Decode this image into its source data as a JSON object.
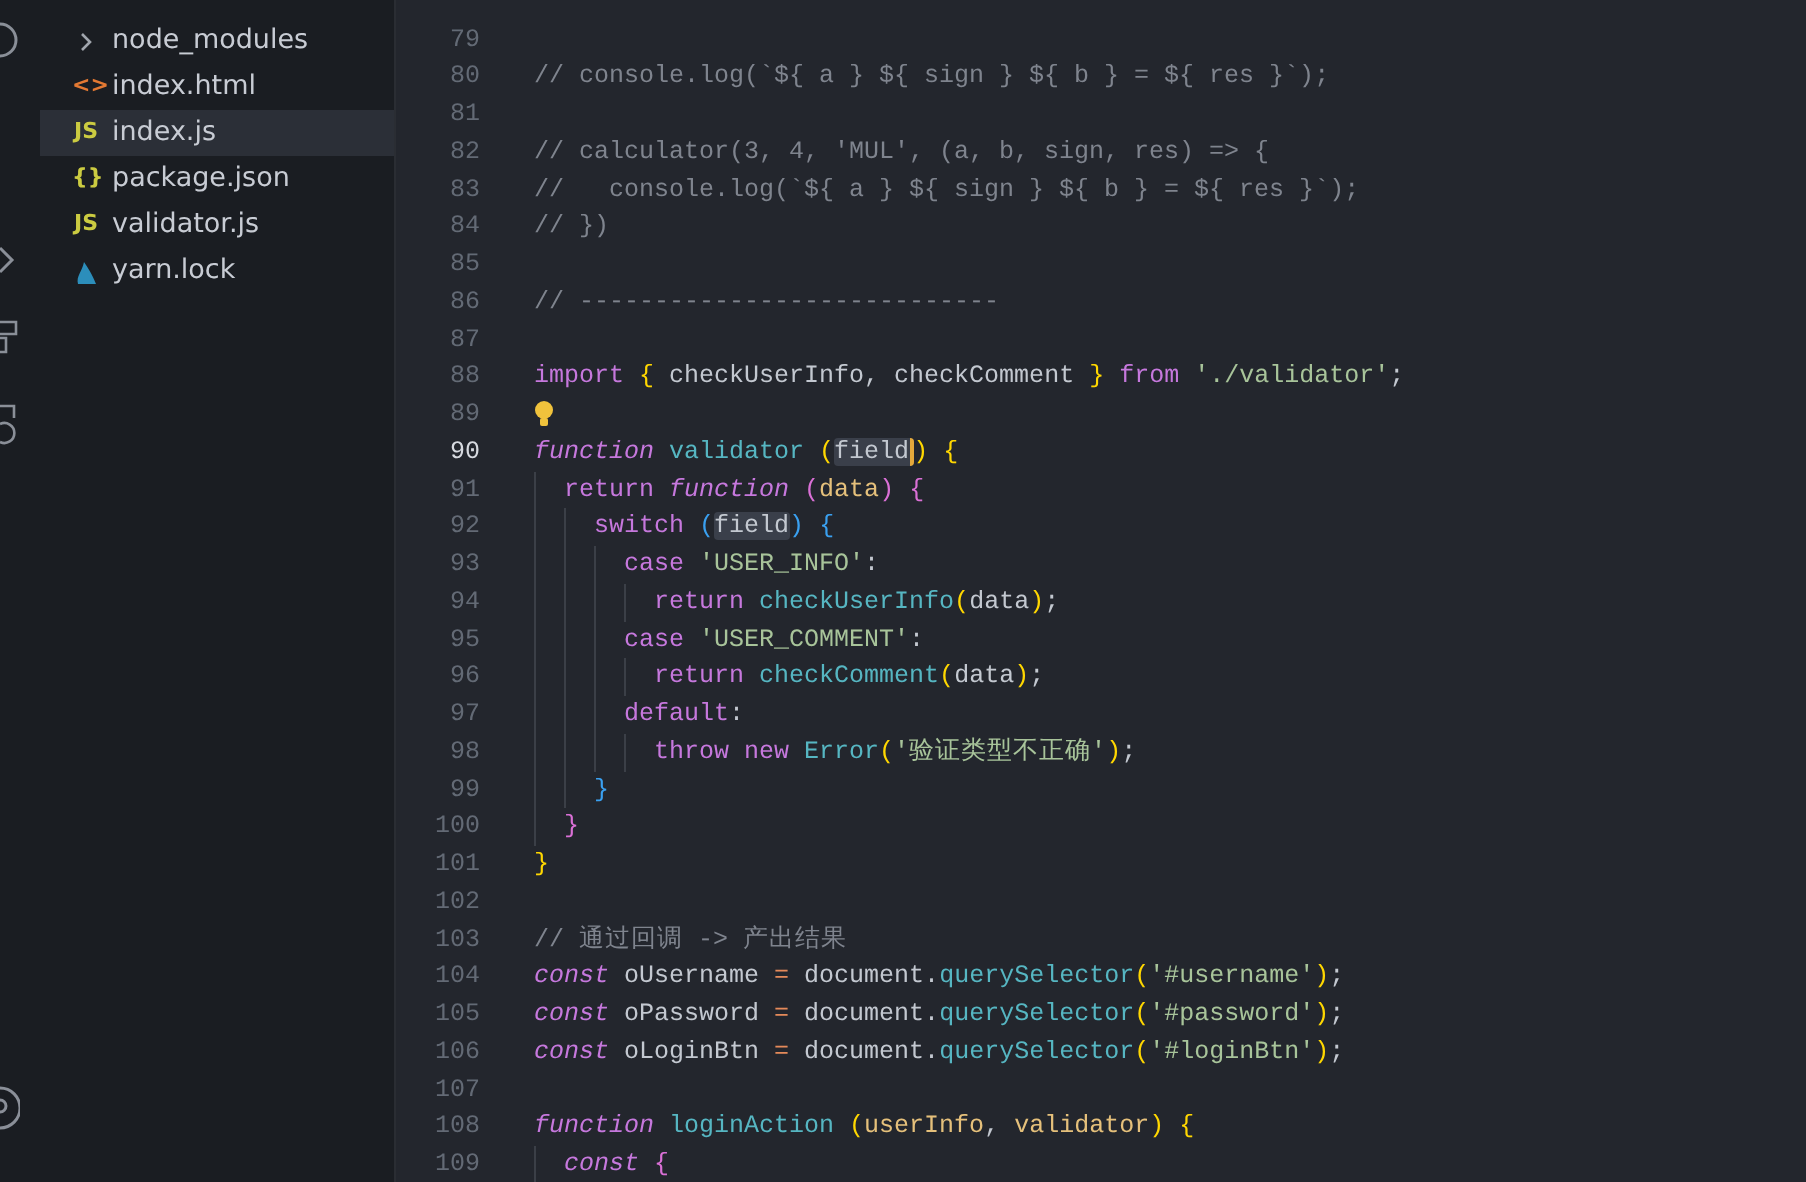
{
  "explorer": {
    "items": [
      {
        "name": "node_modules",
        "kind": "folder",
        "selected": false
      },
      {
        "name": "index.html",
        "kind": "html",
        "glyph": "<>",
        "selected": false
      },
      {
        "name": "index.js",
        "kind": "js",
        "glyph": "JS",
        "selected": true
      },
      {
        "name": "package.json",
        "kind": "json",
        "glyph": "{}",
        "selected": false
      },
      {
        "name": "validator.js",
        "kind": "js",
        "glyph": "JS",
        "selected": false
      },
      {
        "name": "yarn.lock",
        "kind": "yarn",
        "selected": false
      }
    ]
  },
  "editor": {
    "lines": [
      {
        "number": "79",
        "current": false
      },
      {
        "number": "80",
        "current": false,
        "tokens": [
          {
            "kind": "comment",
            "text": "// console.log(`${ a } ${ sign } ${ b } = ${ res }`);"
          }
        ]
      },
      {
        "number": "81",
        "current": false
      },
      {
        "number": "82",
        "current": false,
        "tokens": [
          {
            "kind": "comment",
            "text": "// calculator(3, 4, 'MUL', (a, b, sign, res) => {"
          }
        ]
      },
      {
        "number": "83",
        "current": false,
        "tokens": [
          {
            "kind": "comment",
            "text": "//   console.log(`${ a } ${ sign } ${ b } = ${ res }`);"
          }
        ]
      },
      {
        "number": "84",
        "current": false,
        "tokens": [
          {
            "kind": "comment",
            "text": "// })"
          }
        ]
      },
      {
        "number": "85",
        "current": false
      },
      {
        "number": "86",
        "current": false,
        "tokens": [
          {
            "kind": "comment",
            "text": "// ----------------------------"
          }
        ]
      },
      {
        "number": "87",
        "current": false
      },
      {
        "number": "88",
        "current": false,
        "tokens": [
          {
            "kind": "keyword",
            "text": "import"
          },
          {
            "kind": "bracket1",
            "text": " {"
          },
          {
            "kind": "plain",
            "text": " checkUserInfo, checkComment"
          },
          {
            "kind": "bracket1",
            "text": " }"
          },
          {
            "kind": "keyword",
            "text": " from"
          },
          {
            "kind": "string",
            "text": " './validator'"
          },
          {
            "kind": "plain",
            "text": ";"
          }
        ]
      },
      {
        "number": "89",
        "current": false,
        "lightbulb": true
      },
      {
        "number": "90",
        "current": true,
        "tokens": [
          {
            "kind": "storage",
            "text": "function"
          },
          {
            "kind": "function",
            "text": " validator"
          },
          {
            "kind": "bracket1",
            "text": " ("
          },
          {
            "kind": "plain",
            "text": "field",
            "highlighted": true,
            "cursor_after": true
          },
          {
            "kind": "bracket1",
            "text": ")"
          },
          {
            "kind": "bracket1",
            "text": " {"
          }
        ]
      },
      {
        "number": "91",
        "current": false,
        "tokens": [
          {
            "kind": "keyword",
            "text": "  return"
          },
          {
            "kind": "storage",
            "text": " function"
          },
          {
            "kind": "bracket2",
            "text": " ("
          },
          {
            "kind": "param",
            "text": "data"
          },
          {
            "kind": "bracket2",
            "text": ")"
          },
          {
            "kind": "bracket2",
            "text": " {"
          }
        ]
      },
      {
        "number": "92",
        "current": false,
        "tokens": [
          {
            "kind": "keyword",
            "text": "    switch"
          },
          {
            "kind": "bracket3",
            "text": " ("
          },
          {
            "kind": "plain",
            "text": "field",
            "highlighted": true
          },
          {
            "kind": "bracket3",
            "text": ")"
          },
          {
            "kind": "bracket3",
            "text": " {"
          }
        ]
      },
      {
        "number": "93",
        "current": false,
        "tokens": [
          {
            "kind": "keyword",
            "text": "      case"
          },
          {
            "kind": "string",
            "text": " 'USER_INFO'"
          },
          {
            "kind": "plain",
            "text": ":"
          }
        ]
      },
      {
        "number": "94",
        "current": false,
        "tokens": [
          {
            "kind": "keyword",
            "text": "        return"
          },
          {
            "kind": "function",
            "text": " checkUserInfo"
          },
          {
            "kind": "bracket1",
            "text": "("
          },
          {
            "kind": "plain",
            "text": "data"
          },
          {
            "kind": "bracket1",
            "text": ")"
          },
          {
            "kind": "plain",
            "text": ";"
          }
        ]
      },
      {
        "number": "95",
        "current": false,
        "tokens": [
          {
            "kind": "keyword",
            "text": "      case"
          },
          {
            "kind": "string",
            "text": " 'USER_COMMENT'"
          },
          {
            "kind": "plain",
            "text": ":"
          }
        ]
      },
      {
        "number": "96",
        "current": false,
        "tokens": [
          {
            "kind": "keyword",
            "text": "        return"
          },
          {
            "kind": "function",
            "text": " checkComment"
          },
          {
            "kind": "bracket1",
            "text": "("
          },
          {
            "kind": "plain",
            "text": "data"
          },
          {
            "kind": "bracket1",
            "text": ")"
          },
          {
            "kind": "plain",
            "text": ";"
          }
        ]
      },
      {
        "number": "97",
        "current": false,
        "tokens": [
          {
            "kind": "keyword",
            "text": "      default"
          },
          {
            "kind": "plain",
            "text": ":"
          }
        ]
      },
      {
        "number": "98",
        "current": false,
        "tokens": [
          {
            "kind": "keyword",
            "text": "        throw new"
          },
          {
            "kind": "function",
            "text": " Error"
          },
          {
            "kind": "bracket1",
            "text": "("
          },
          {
            "kind": "string",
            "text": "'验证类型不正确'"
          },
          {
            "kind": "bracket1",
            "text": ")"
          },
          {
            "kind": "plain",
            "text": ";"
          }
        ]
      },
      {
        "number": "99",
        "current": false,
        "tokens": [
          {
            "kind": "bracket3",
            "text": "    }"
          }
        ]
      },
      {
        "number": "100",
        "current": false,
        "tokens": [
          {
            "kind": "bracket2",
            "text": "  }"
          }
        ]
      },
      {
        "number": "101",
        "current": false,
        "tokens": [
          {
            "kind": "bracket1",
            "text": "}"
          }
        ]
      },
      {
        "number": "102",
        "current": false
      },
      {
        "number": "103",
        "current": false,
        "tokens": [
          {
            "kind": "comment",
            "text": "// 通过回调 -> 产出结果"
          }
        ]
      },
      {
        "number": "104",
        "current": false,
        "tokens": [
          {
            "kind": "storage",
            "text": "const"
          },
          {
            "kind": "plain",
            "text": " oUsername"
          },
          {
            "kind": "operator",
            "text": " ="
          },
          {
            "kind": "plain",
            "text": " document."
          },
          {
            "kind": "method",
            "text": "querySelector"
          },
          {
            "kind": "bracket1",
            "text": "("
          },
          {
            "kind": "string",
            "text": "'#username'"
          },
          {
            "kind": "bracket1",
            "text": ")"
          },
          {
            "kind": "plain",
            "text": ";"
          }
        ]
      },
      {
        "number": "105",
        "current": false,
        "tokens": [
          {
            "kind": "storage",
            "text": "const"
          },
          {
            "kind": "plain",
            "text": " oPassword"
          },
          {
            "kind": "operator",
            "text": " ="
          },
          {
            "kind": "plain",
            "text": " document."
          },
          {
            "kind": "method",
            "text": "querySelector"
          },
          {
            "kind": "bracket1",
            "text": "("
          },
          {
            "kind": "string",
            "text": "'#password'"
          },
          {
            "kind": "bracket1",
            "text": ")"
          },
          {
            "kind": "plain",
            "text": ";"
          }
        ]
      },
      {
        "number": "106",
        "current": false,
        "tokens": [
          {
            "kind": "storage",
            "text": "const"
          },
          {
            "kind": "plain",
            "text": " oLoginBtn"
          },
          {
            "kind": "operator",
            "text": " ="
          },
          {
            "kind": "plain",
            "text": " document."
          },
          {
            "kind": "method",
            "text": "querySelector"
          },
          {
            "kind": "bracket1",
            "text": "("
          },
          {
            "kind": "string",
            "text": "'#loginBtn'"
          },
          {
            "kind": "bracket1",
            "text": ")"
          },
          {
            "kind": "plain",
            "text": ";"
          }
        ]
      },
      {
        "number": "107",
        "current": false
      },
      {
        "number": "108",
        "current": false,
        "tokens": [
          {
            "kind": "storage",
            "text": "function"
          },
          {
            "kind": "function",
            "text": " loginAction"
          },
          {
            "kind": "bracket1",
            "text": " ("
          },
          {
            "kind": "param",
            "text": "userInfo"
          },
          {
            "kind": "plain",
            "text": ","
          },
          {
            "kind": "param",
            "text": " validator"
          },
          {
            "kind": "bracket1",
            "text": ")"
          },
          {
            "kind": "bracket1",
            "text": " {"
          }
        ]
      },
      {
        "number": "109",
        "current": false,
        "tokens": [
          {
            "kind": "storage",
            "text": "  const"
          },
          {
            "kind": "bracket2",
            "text": " {"
          }
        ]
      }
    ]
  }
}
